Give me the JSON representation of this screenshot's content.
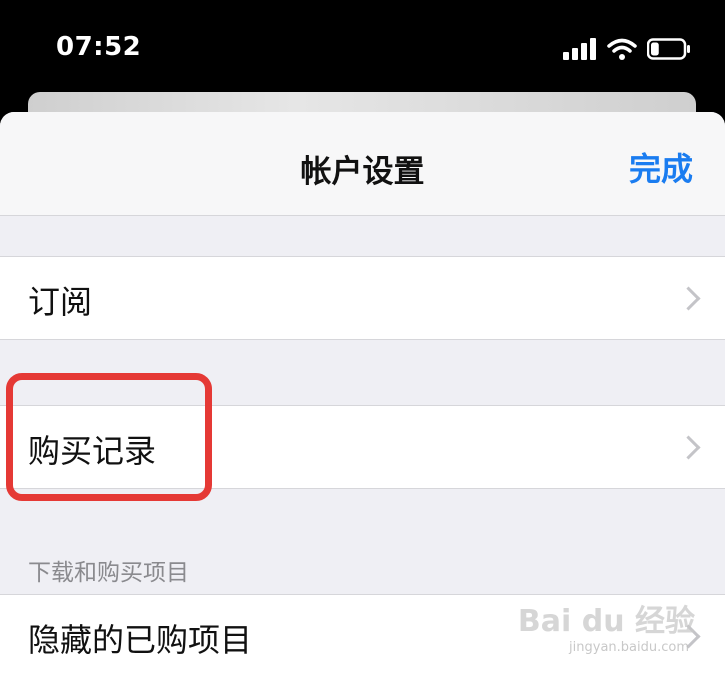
{
  "status_bar": {
    "time": "07:52",
    "battery_level": 0.25
  },
  "nav": {
    "title": "帐户设置",
    "done_label": "完成"
  },
  "rows": {
    "subscriptions": "订阅",
    "purchase_history": "购买记录"
  },
  "section": {
    "downloads_header": "下载和购买项目",
    "hidden_purchases": "隐藏的已购项目"
  },
  "watermark": {
    "text": "Bai du 经验",
    "sub": "jingyan.baidu.com"
  },
  "colors": {
    "accent": "#1a7cf0",
    "highlight": "#e53935"
  }
}
